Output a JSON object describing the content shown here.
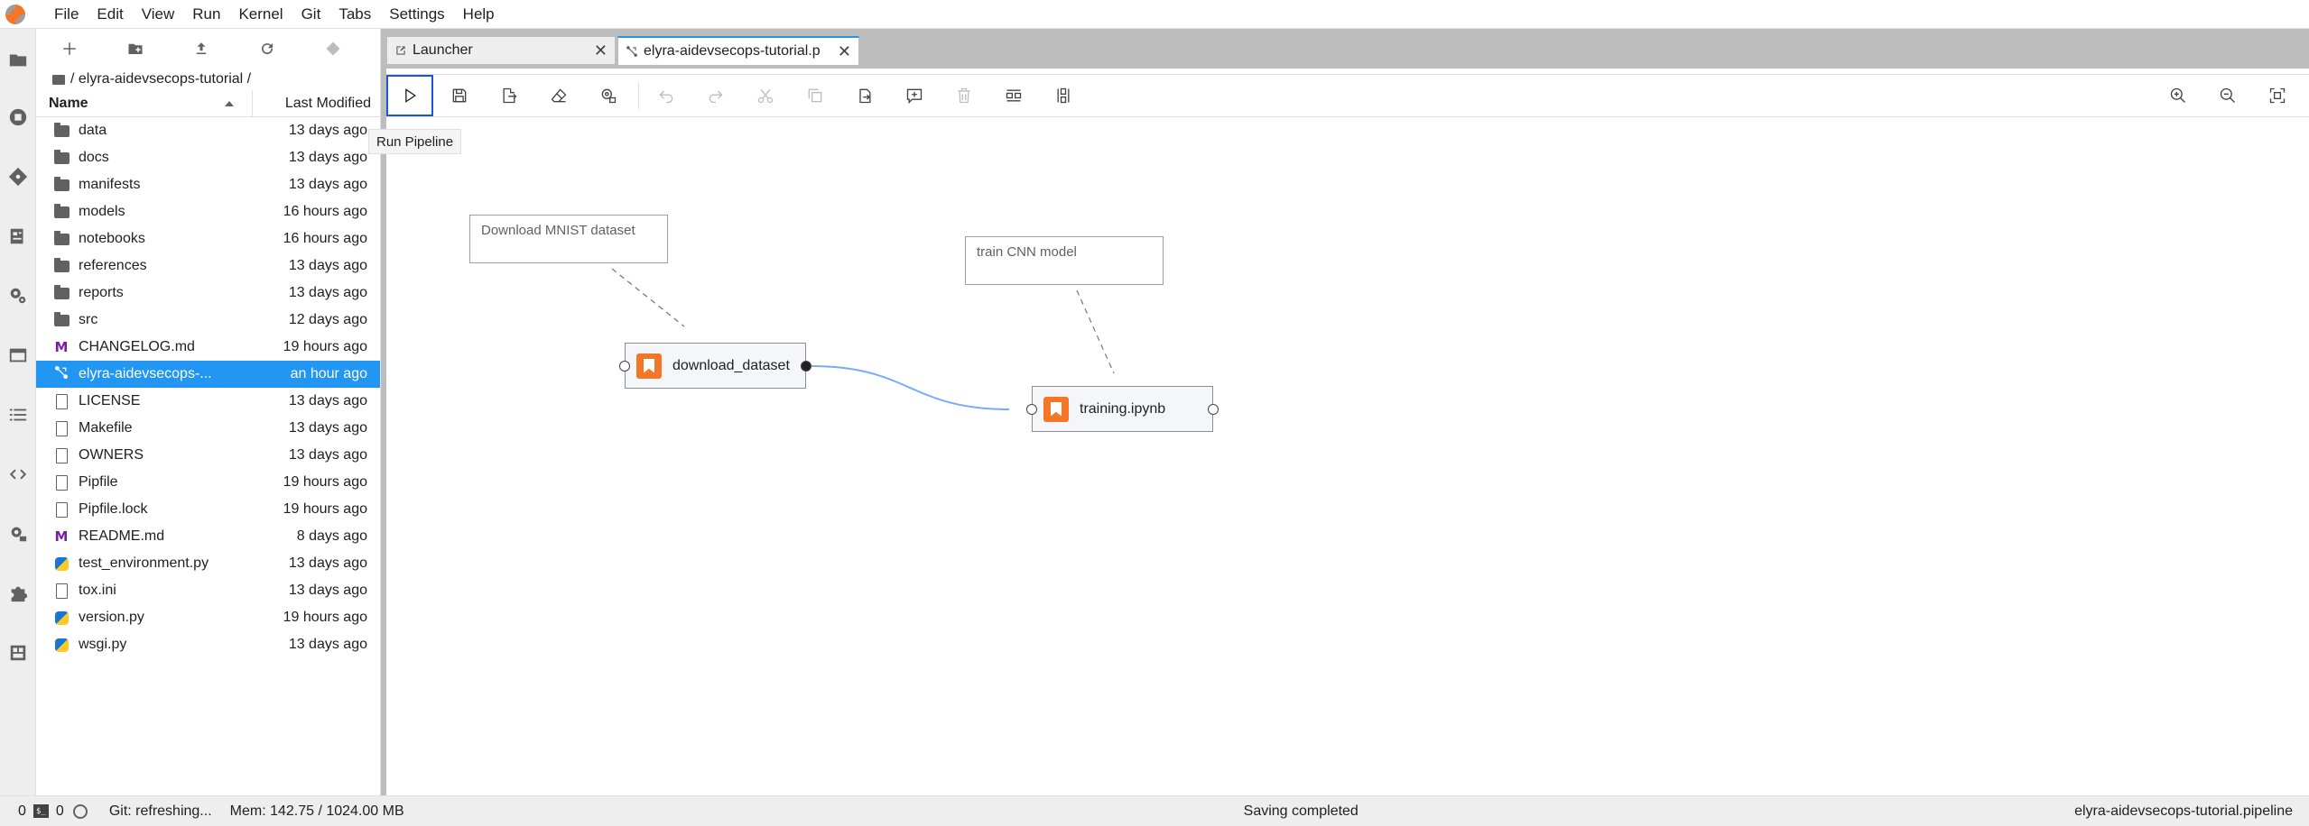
{
  "menu": [
    "File",
    "Edit",
    "View",
    "Run",
    "Kernel",
    "Git",
    "Tabs",
    "Settings",
    "Help"
  ],
  "breadcrumb": "/ elyra-aidevsecops-tutorial /",
  "filebrowser": {
    "col_name": "Name",
    "col_modified": "Last Modified",
    "files": [
      {
        "name": "data",
        "modified": "13 days ago",
        "icon": "folder-icon"
      },
      {
        "name": "docs",
        "modified": "13 days ago",
        "icon": "folder-icon"
      },
      {
        "name": "manifests",
        "modified": "13 days ago",
        "icon": "folder-icon"
      },
      {
        "name": "models",
        "modified": "16 hours ago",
        "icon": "folder-icon"
      },
      {
        "name": "notebooks",
        "modified": "16 hours ago",
        "icon": "folder-icon"
      },
      {
        "name": "references",
        "modified": "13 days ago",
        "icon": "folder-icon"
      },
      {
        "name": "reports",
        "modified": "13 days ago",
        "icon": "folder-icon"
      },
      {
        "name": "src",
        "modified": "12 days ago",
        "icon": "folder-icon"
      },
      {
        "name": "CHANGELOG.md",
        "modified": "19 hours ago",
        "icon": "markdown-icon"
      },
      {
        "name": "elyra-aidevsecops-...",
        "modified": "an hour ago",
        "icon": "pipeline-icon",
        "selected": true
      },
      {
        "name": "LICENSE",
        "modified": "13 days ago",
        "icon": "file-icon"
      },
      {
        "name": "Makefile",
        "modified": "13 days ago",
        "icon": "file-icon"
      },
      {
        "name": "OWNERS",
        "modified": "13 days ago",
        "icon": "file-icon"
      },
      {
        "name": "Pipfile",
        "modified": "19 hours ago",
        "icon": "file-icon"
      },
      {
        "name": "Pipfile.lock",
        "modified": "19 hours ago",
        "icon": "file-icon"
      },
      {
        "name": "README.md",
        "modified": "8 days ago",
        "icon": "markdown-icon"
      },
      {
        "name": "test_environment.py",
        "modified": "13 days ago",
        "icon": "python-icon"
      },
      {
        "name": "tox.ini",
        "modified": "13 days ago",
        "icon": "file-icon"
      },
      {
        "name": "version.py",
        "modified": "19 hours ago",
        "icon": "python-icon"
      },
      {
        "name": "wsgi.py",
        "modified": "13 days ago",
        "icon": "python-icon"
      }
    ]
  },
  "tabs": {
    "launcher": "Launcher",
    "pipeline": "elyra-aidevsecops-tutorial.p"
  },
  "tooltip": "Run Pipeline",
  "pipeline": {
    "comments": [
      "Download MNIST dataset",
      "train CNN model"
    ],
    "nodes": [
      "download_dataset",
      "training.ipynb"
    ]
  },
  "status": {
    "kernels": "0",
    "terminals": "0",
    "terminal_glyph": "$_",
    "git": "Git: refreshing...",
    "mem": "Mem: 142.75 / 1024.00 MB",
    "saving": "Saving completed",
    "filename": "elyra-aidevsecops-tutorial.pipeline"
  },
  "colors": {
    "accent": "#2196f3",
    "node_icon": "#f37726",
    "link": "#78a9ff"
  }
}
